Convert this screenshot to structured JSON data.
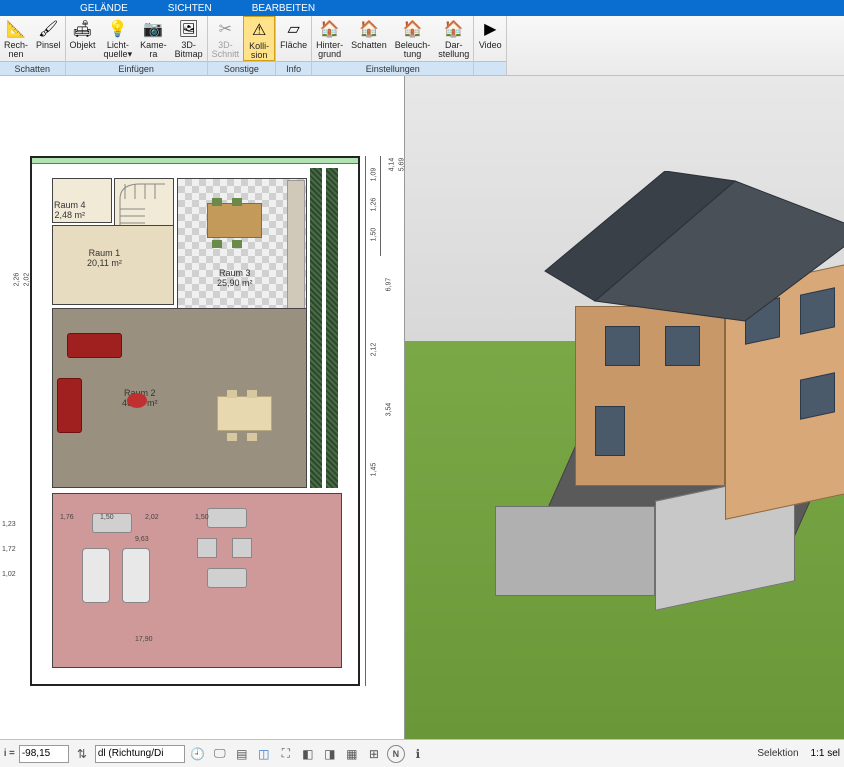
{
  "menu": {
    "tabs": [
      "GELÄNDE",
      "SICHTEN",
      "BEARBEITEN"
    ]
  },
  "ribbon": {
    "groups": [
      {
        "label": "Schatten",
        "items": [
          {
            "name": "rechnen",
            "label": "Rech-\nnen",
            "icon": "📐"
          },
          {
            "name": "pinsel",
            "label": "Pinsel",
            "icon": "🖌"
          }
        ]
      },
      {
        "label": "Einfügen",
        "items": [
          {
            "name": "objekt",
            "label": "Objekt",
            "icon": "🛋"
          },
          {
            "name": "lichtquelle",
            "label": "Licht-\nquelle▾",
            "icon": "💡"
          },
          {
            "name": "kamera",
            "label": "Kame-\nra",
            "icon": "📷"
          },
          {
            "name": "3d-bitmap",
            "label": "3D-\nBitmap",
            "icon": "🖼"
          }
        ]
      },
      {
        "label": "Sonstige",
        "items": [
          {
            "name": "3d-schnitt",
            "label": "3D-\nSchnitt",
            "icon": "✂",
            "disabled": true
          },
          {
            "name": "kollision",
            "label": "Kolli-\nsion",
            "icon": "⚠",
            "active": true
          }
        ]
      },
      {
        "label": "Info",
        "items": [
          {
            "name": "flaeche",
            "label": "Fläche",
            "icon": "▱"
          }
        ]
      },
      {
        "label": "Einstellungen",
        "items": [
          {
            "name": "hintergrund",
            "label": "Hinter-\ngrund",
            "icon": "🏠"
          },
          {
            "name": "schatten",
            "label": "Schatten",
            "icon": "🏠"
          },
          {
            "name": "beleuchtung",
            "label": "Beleuch-\ntung",
            "icon": "🏠"
          },
          {
            "name": "darstellung",
            "label": "Dar-\nstellung",
            "icon": "🏠"
          }
        ]
      },
      {
        "label": "",
        "items": [
          {
            "name": "video",
            "label": "Video",
            "icon": "▶"
          }
        ]
      }
    ]
  },
  "plan": {
    "rooms": [
      {
        "id": "raum4",
        "name": "Raum 4",
        "area": "2,48 m²"
      },
      {
        "id": "raum1",
        "name": "Raum 1",
        "area": "20,11 m²"
      },
      {
        "id": "raum3",
        "name": "Raum 3",
        "area": "25,90 m²"
      },
      {
        "id": "raum2",
        "name": "Raum 2",
        "area": "46,45 m²"
      }
    ],
    "dims_right": [
      "1,09",
      "1,26",
      "1,50",
      "6,97",
      "2,12",
      "3,54",
      "1,45"
    ],
    "dims_right_outer": [
      "4,14",
      "5,69"
    ],
    "dims_left": [
      "2,26",
      "2,02"
    ],
    "dims_bottom": [
      "1,76",
      "1,50",
      "2,02",
      "1,50"
    ],
    "dims_bottom2": "9,63",
    "dims_bottom3": "17,90",
    "dims_corner": [
      "1,23",
      "1,72",
      "1,02"
    ]
  },
  "statusbar": {
    "coord_label": "i =",
    "coord_value": "-98,15",
    "dropdown": "dl (Richtung/Di",
    "right": "Selektion",
    "scale": "1:1 sel"
  }
}
